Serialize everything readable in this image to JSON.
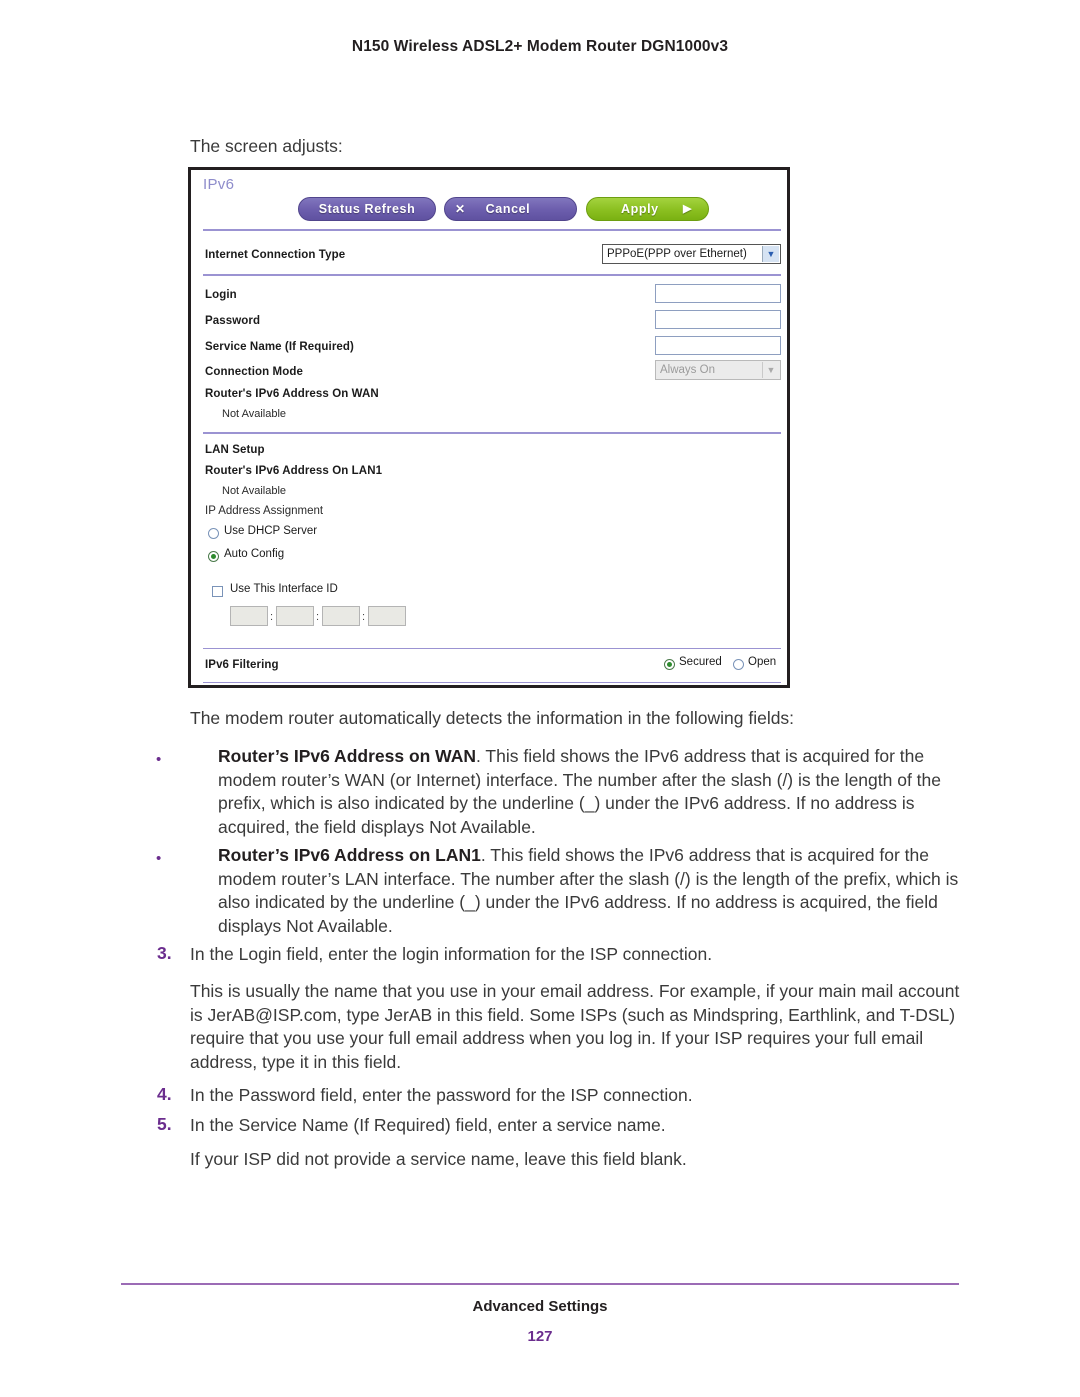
{
  "running_head": "N150 Wireless ADSL2+ Modem Router DGN1000v3",
  "intro_line": "The screen adjusts:",
  "screenshot": {
    "panel_title": "IPv6",
    "buttons": {
      "status_refresh": "Status Refresh",
      "cancel": "Cancel",
      "cancel_icon": "x-icon",
      "apply": "Apply",
      "apply_icon": "arrow-right-icon"
    },
    "internet_connection_type": {
      "label": "Internet Connection Type",
      "value": "PPPoE(PPP over Ethernet)"
    },
    "fields": {
      "login_label": "Login",
      "login_value": "",
      "password_label": "Password",
      "password_value": "",
      "service_name_label": "Service Name (If Required)",
      "service_name_value": "",
      "connection_mode_label": "Connection Mode",
      "connection_mode_value": "Always On",
      "wan_addr_label": "Router's IPv6 Address On WAN",
      "wan_addr_value": "Not Available"
    },
    "lan_setup": {
      "heading": "LAN Setup",
      "lan_addr_label": "Router's IPv6 Address On LAN1",
      "lan_addr_value": "Not Available",
      "ip_assignment_label": "IP Address Assignment",
      "option_dhcp": "Use DHCP Server",
      "option_auto": "Auto Config",
      "selected_option": "Auto Config",
      "use_interface_id_label": "Use This Interface ID",
      "use_interface_id_checked": false,
      "interface_id_values": [
        "",
        "",
        "",
        ""
      ],
      "interface_id_separator": ":"
    },
    "ipv6_filtering": {
      "label": "IPv6 Filtering",
      "option_secured": "Secured",
      "option_open": "Open",
      "selected": "Secured"
    },
    "colors": {
      "button_purple": "#6d5fae",
      "button_green": "#8dc122",
      "panel_title": "#8e8ccb",
      "rule": "#9b93d2"
    }
  },
  "body": {
    "lead_in": "The modem router automatically detects the information in the following fields:",
    "bullets": [
      {
        "term": "Router’s IPv6 Address on WAN",
        "text": ". This field shows the IPv6 address that is acquired for the modem router’s WAN (or Internet) interface. The number after the slash (/) is the length of the prefix, which is also indicated by the underline (_) under the IPv6 address. If no address is acquired, the field displays Not Available."
      },
      {
        "term": "Router’s IPv6 Address on LAN1",
        "text": ". This field shows the IPv6 address that is acquired for the modem router’s LAN interface. The number after the slash (/) is the length of the prefix, which is also indicated by the underline (_) under the IPv6 address. If no address is acquired, the field displays Not Available."
      }
    ],
    "step3_num": "3.",
    "step3_text": "In the Login field, enter the login information for the ISP connection.",
    "step3_para": "This is usually the name that you use in your email address. For example, if your main mail account is JerAB@ISP.com, type JerAB in this field. Some ISPs (such as Mindspring, Earthlink, and T-DSL) require that you use your full email address when you log in. If your ISP requires your full email address, type it in this field.",
    "step4_num": "4.",
    "step4_text": "In the Password field, enter the password for the ISP connection.",
    "step5_num": "5.",
    "step5_text": "In the Service Name (If Required) field, enter a service name.",
    "step5_para": "If your ISP did not provide a service name, leave this field blank."
  },
  "footer": {
    "title": "Advanced Settings",
    "page_number": "127"
  }
}
